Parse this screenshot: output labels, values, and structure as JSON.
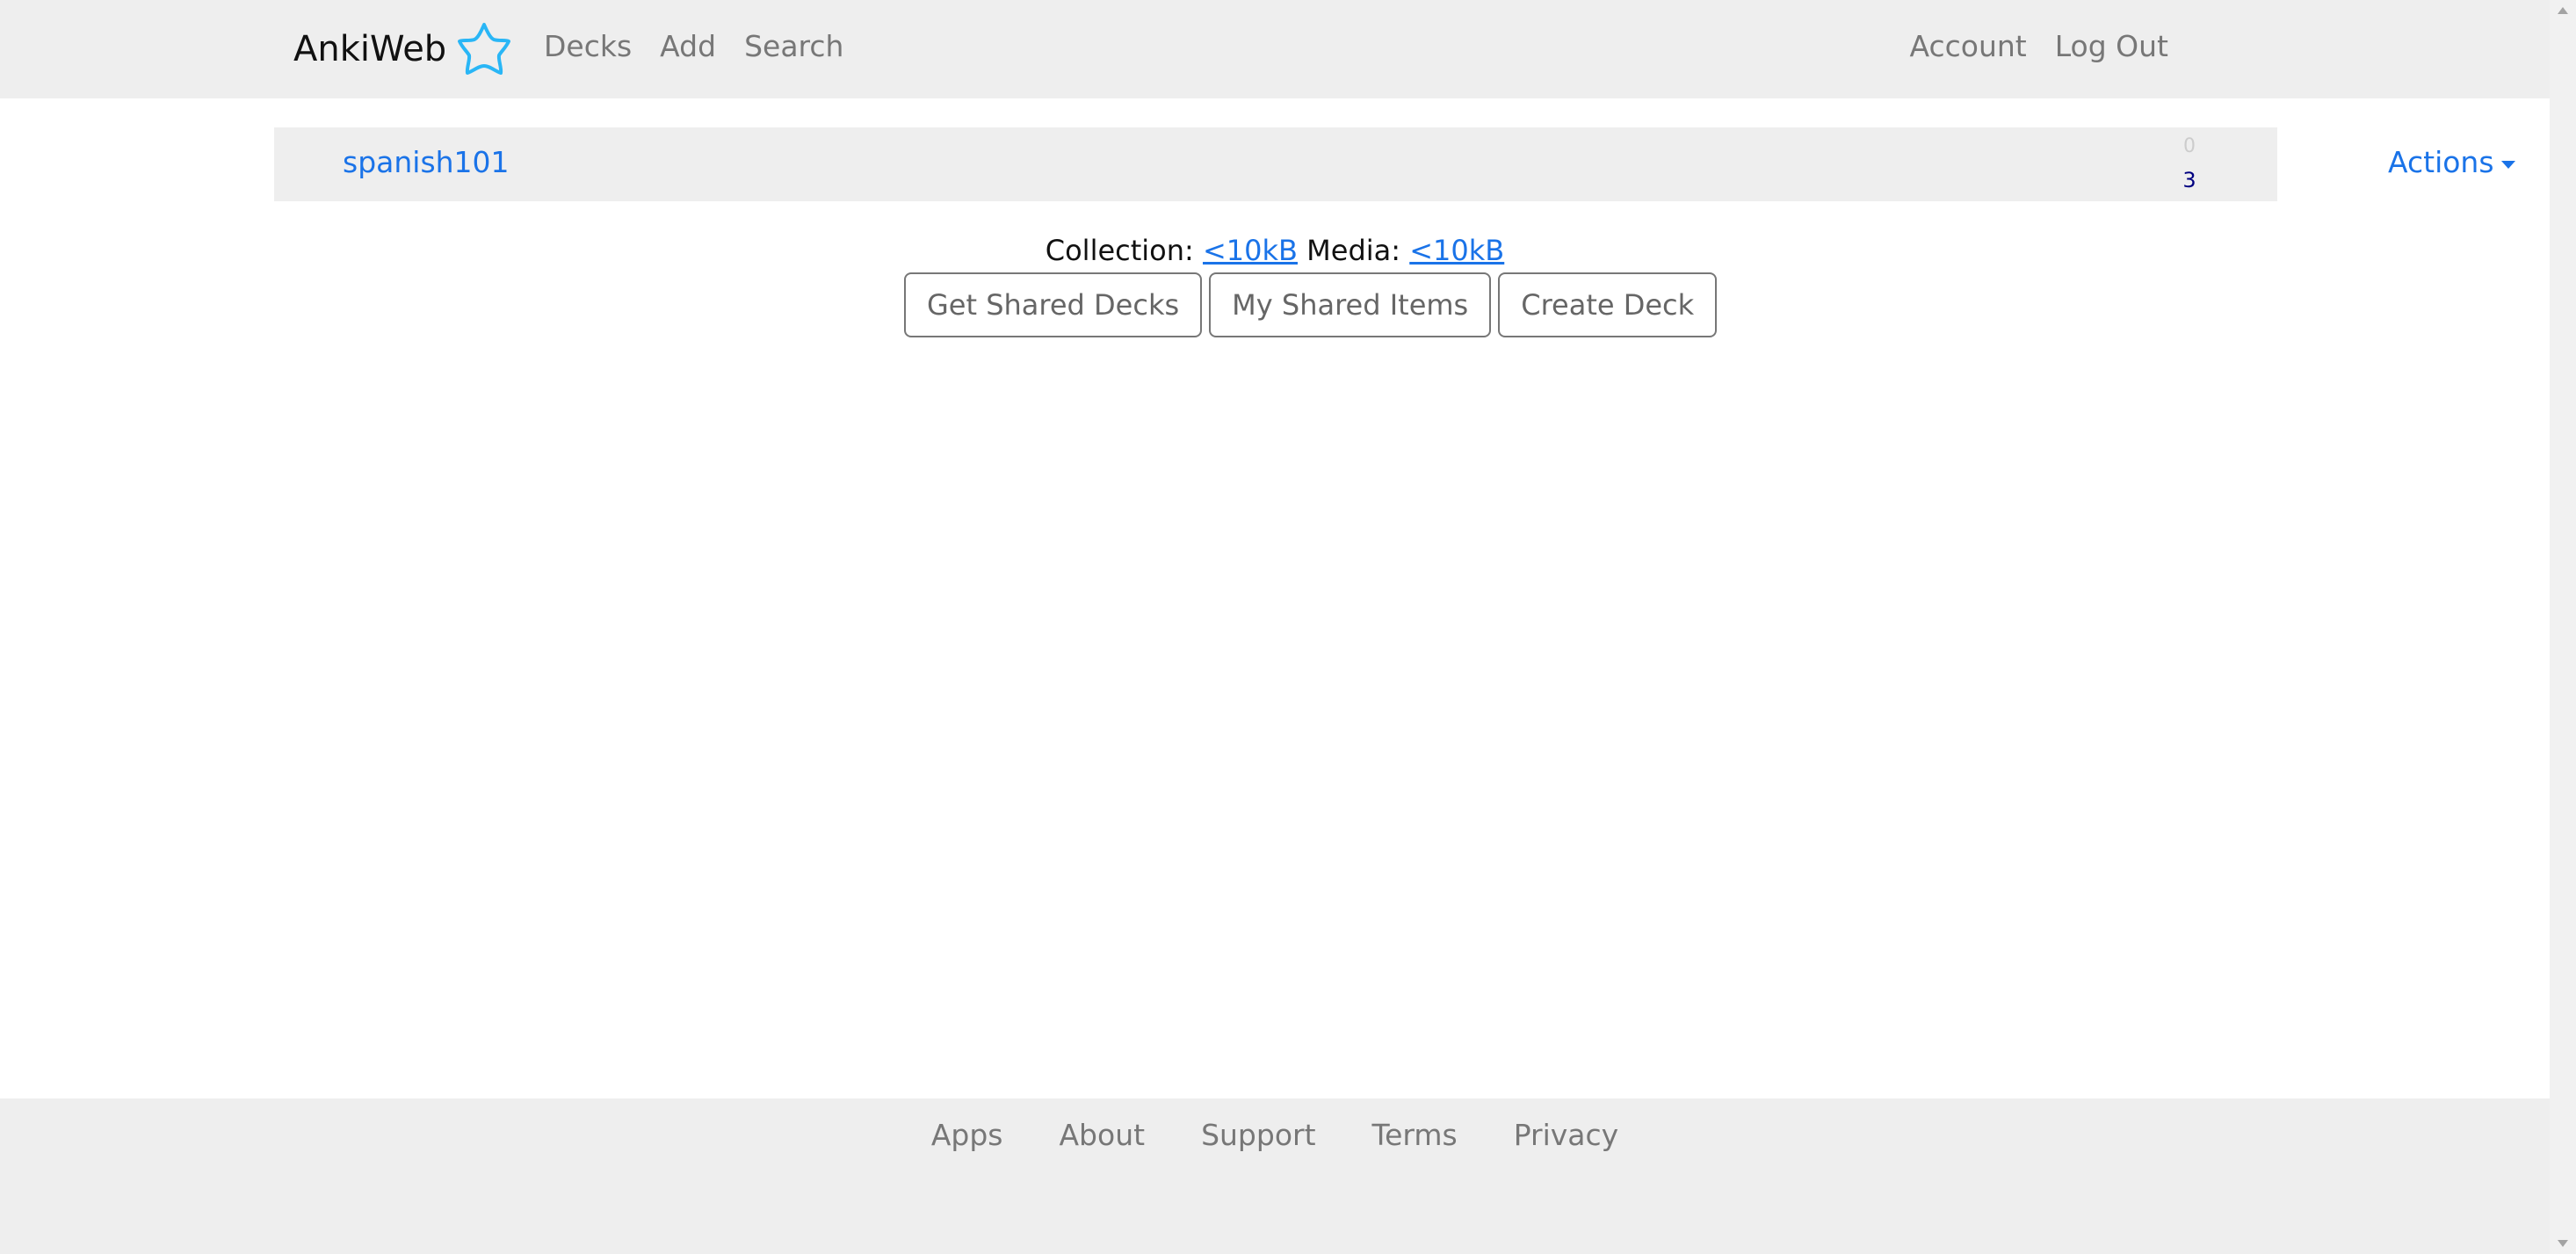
{
  "navbar": {
    "brand": "AnkiWeb",
    "brand_icon": "anki-star-icon",
    "left_links": [
      "Decks",
      "Add",
      "Search"
    ],
    "right_links": [
      "Account",
      "Log Out"
    ]
  },
  "decks": [
    {
      "name": "spanish101",
      "due_count": "0",
      "new_count": "3",
      "actions_label": "Actions"
    }
  ],
  "collection": {
    "collection_label": "Collection:",
    "collection_size": "<10kB",
    "media_label": "Media:",
    "media_size": "<10kB"
  },
  "buttons": {
    "get_shared_decks": "Get Shared Decks",
    "my_shared_items": "My Shared Items",
    "create_deck": "Create Deck"
  },
  "footer": {
    "links": [
      "Apps",
      "About",
      "Support",
      "Terms",
      "Privacy"
    ]
  },
  "colors": {
    "link_blue": "#1a73e8",
    "brand_icon_blue": "#29b6f6",
    "nav_bg": "#eeeeee",
    "new_count": "#000080"
  }
}
